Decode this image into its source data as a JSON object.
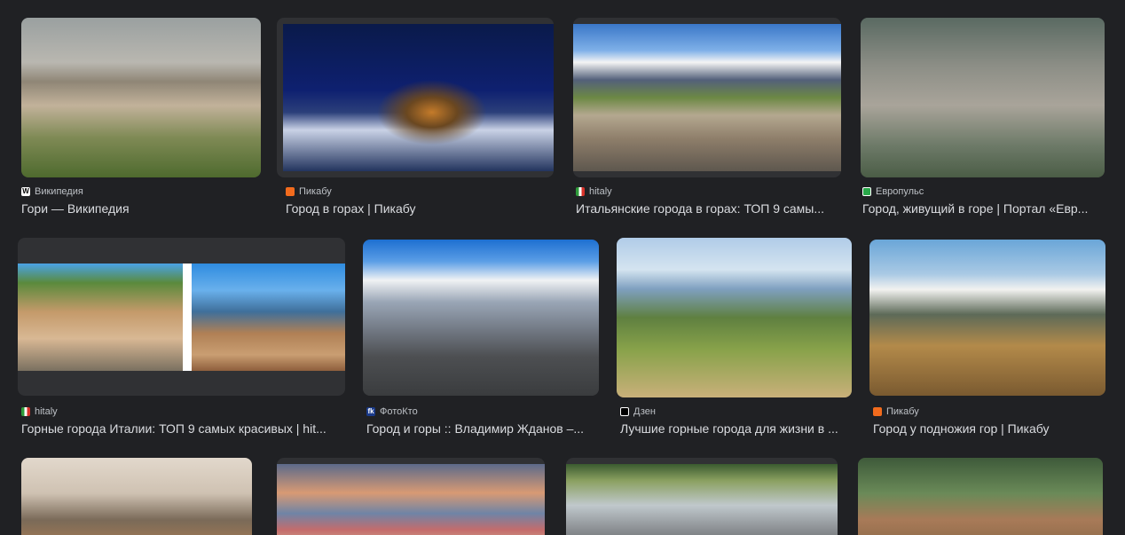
{
  "results": [
    {
      "source": "Википедия",
      "favicon": "W",
      "fav_color": "#ffffff",
      "title": "Гори — Википедия"
    },
    {
      "source": "Пикабу",
      "favicon": "",
      "fav_color": "#f26b1d",
      "title": "Город в горах | Пикабу"
    },
    {
      "source": "hitaly",
      "favicon": "",
      "fav_color": "#2e9b3a",
      "title": "Итальянские города в горах: ТОП 9 самы..."
    },
    {
      "source": "Европульс",
      "favicon": "",
      "fav_color": "#2aa84a",
      "title": "Город, живущий в горе | Портал «Евр..."
    },
    {
      "source": "hitaly",
      "favicon": "",
      "fav_color": "#2e9b3a",
      "title": "Горные города Италии: ТОП 9 самых красивых | hit..."
    },
    {
      "source": "ФотоКто",
      "favicon": "fk",
      "fav_color": "#1a3a8a",
      "title": "Город и горы :: Владимир Жданов –..."
    },
    {
      "source": "Дзен",
      "favicon": "",
      "fav_color": "#000000",
      "title": "Лучшие горные города для жизни в ..."
    },
    {
      "source": "Пикабу",
      "favicon": "",
      "fav_color": "#f26b1d",
      "title": "Город у подножия гор | Пикабу"
    }
  ]
}
